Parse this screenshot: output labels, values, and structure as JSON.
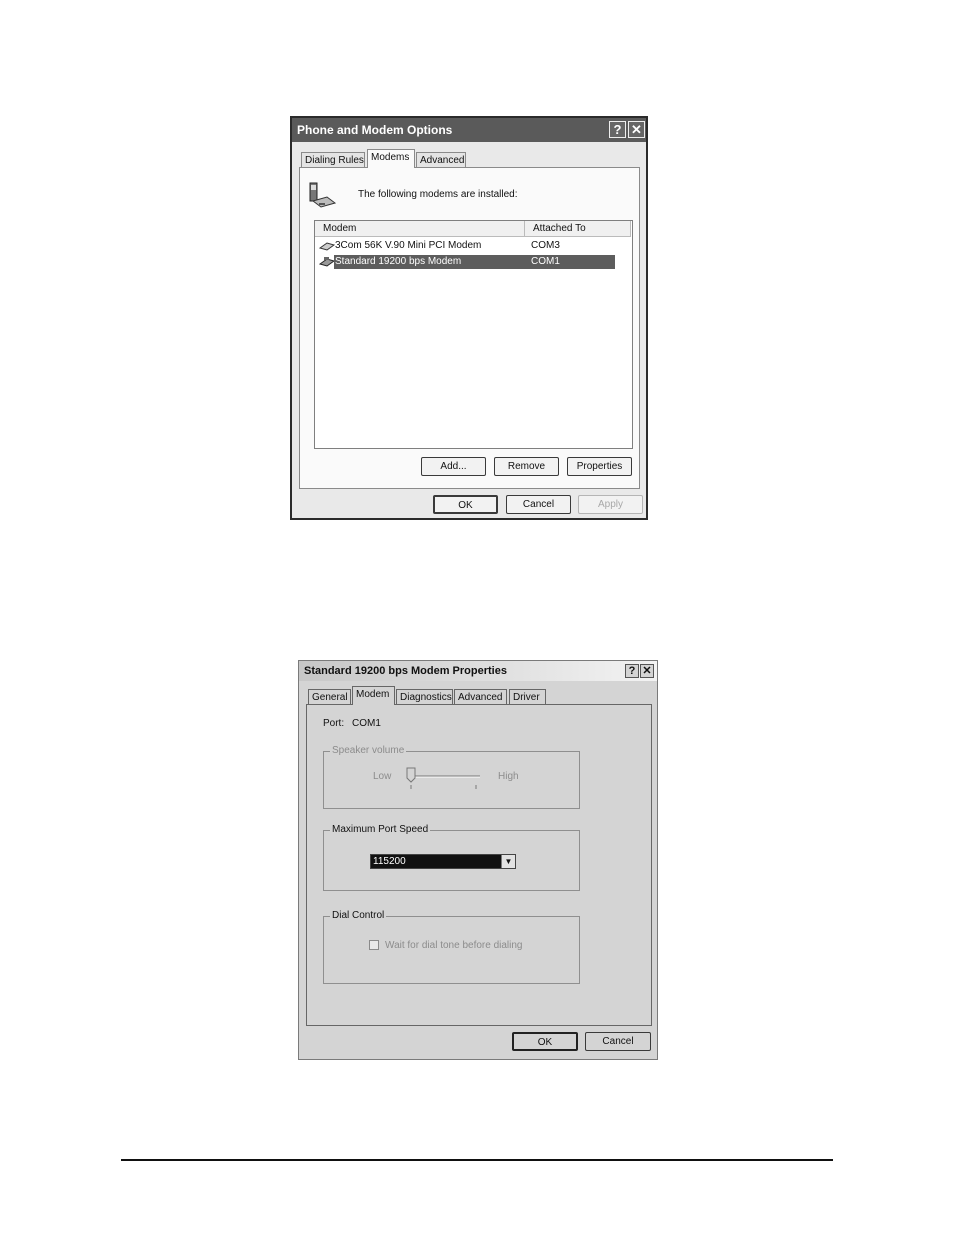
{
  "dialog1": {
    "title": "Phone and Modem Options",
    "tabs": [
      "Dialing Rules",
      "Modems",
      "Advanced"
    ],
    "active_tab": "Modems",
    "intro_text": "The following modems are installed:",
    "list": {
      "columns": [
        "Modem",
        "Attached To"
      ],
      "rows": [
        {
          "modem": "3Com 56K V.90 Mini PCI Modem",
          "port": "COM3",
          "selected": false
        },
        {
          "modem": "Standard 19200 bps Modem",
          "port": "COM1",
          "selected": true
        }
      ]
    },
    "buttons": {
      "add": "Add...",
      "remove": "Remove",
      "properties": "Properties"
    },
    "footer_buttons": {
      "ok": "OK",
      "cancel": "Cancel",
      "apply": "Apply"
    },
    "help_glyph": "?",
    "close_glyph": "✕"
  },
  "dialog2": {
    "title": "Standard 19200 bps Modem Properties",
    "tabs": [
      "General",
      "Modem",
      "Diagnostics",
      "Advanced",
      "Driver"
    ],
    "active_tab": "Modem",
    "port_label": "Port:",
    "port_value": "COM1",
    "speaker_volume": {
      "label": "Speaker volume",
      "low": "Low",
      "high": "High",
      "level": 0,
      "enabled": false
    },
    "max_port_speed": {
      "label": "Maximum Port Speed",
      "value": "115200"
    },
    "dial_control": {
      "label": "Dial Control",
      "checkbox_label": "Wait for dial tone before dialing",
      "checked": false,
      "enabled": false
    },
    "footer_buttons": {
      "ok": "OK",
      "cancel": "Cancel"
    },
    "help_glyph": "?",
    "close_glyph": "✕"
  },
  "icons": {
    "modem_phone_icon": "phone-modem-icon",
    "modem_row_icon": "modem-icon"
  }
}
